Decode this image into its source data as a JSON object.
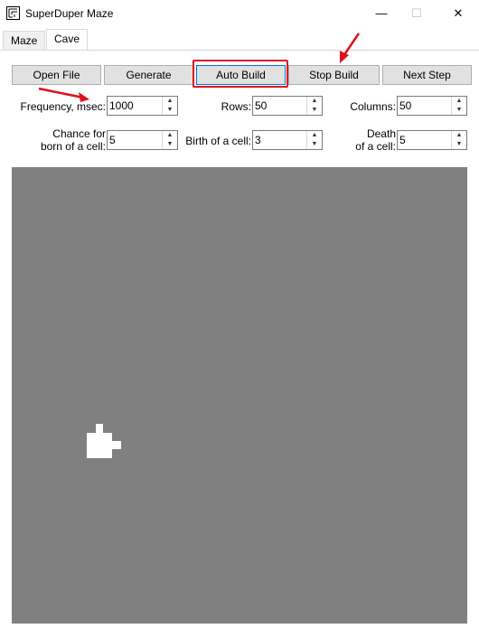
{
  "window": {
    "title": "SuperDuper Maze",
    "controls": {
      "minimize": "—",
      "maximize": "☐",
      "close": "✕"
    }
  },
  "tabs": [
    {
      "label": "Maze",
      "active": false
    },
    {
      "label": "Cave",
      "active": true
    }
  ],
  "toolbar": {
    "open_file": "Open File",
    "generate": "Generate",
    "auto_build": "Auto Build",
    "stop_build": "Stop Build",
    "next_step": "Next Step"
  },
  "fields": {
    "frequency": {
      "label": "Frequency, msec:",
      "value": "1000"
    },
    "rows": {
      "label": "Rows:",
      "value": "50"
    },
    "columns": {
      "label": "Columns:",
      "value": "50"
    },
    "chance_born": {
      "label_line1": "Chance for",
      "label_line2": "born of a cell:",
      "value": "5"
    },
    "birth": {
      "label": "Birth of a cell:",
      "value": "3"
    },
    "death": {
      "label_line1": "Death",
      "label_line2": "of a cell:",
      "value": "5"
    }
  },
  "colors": {
    "canvas_dead": "#808080",
    "canvas_alive": "#ffffff",
    "annotation_red": "#e0101e"
  }
}
